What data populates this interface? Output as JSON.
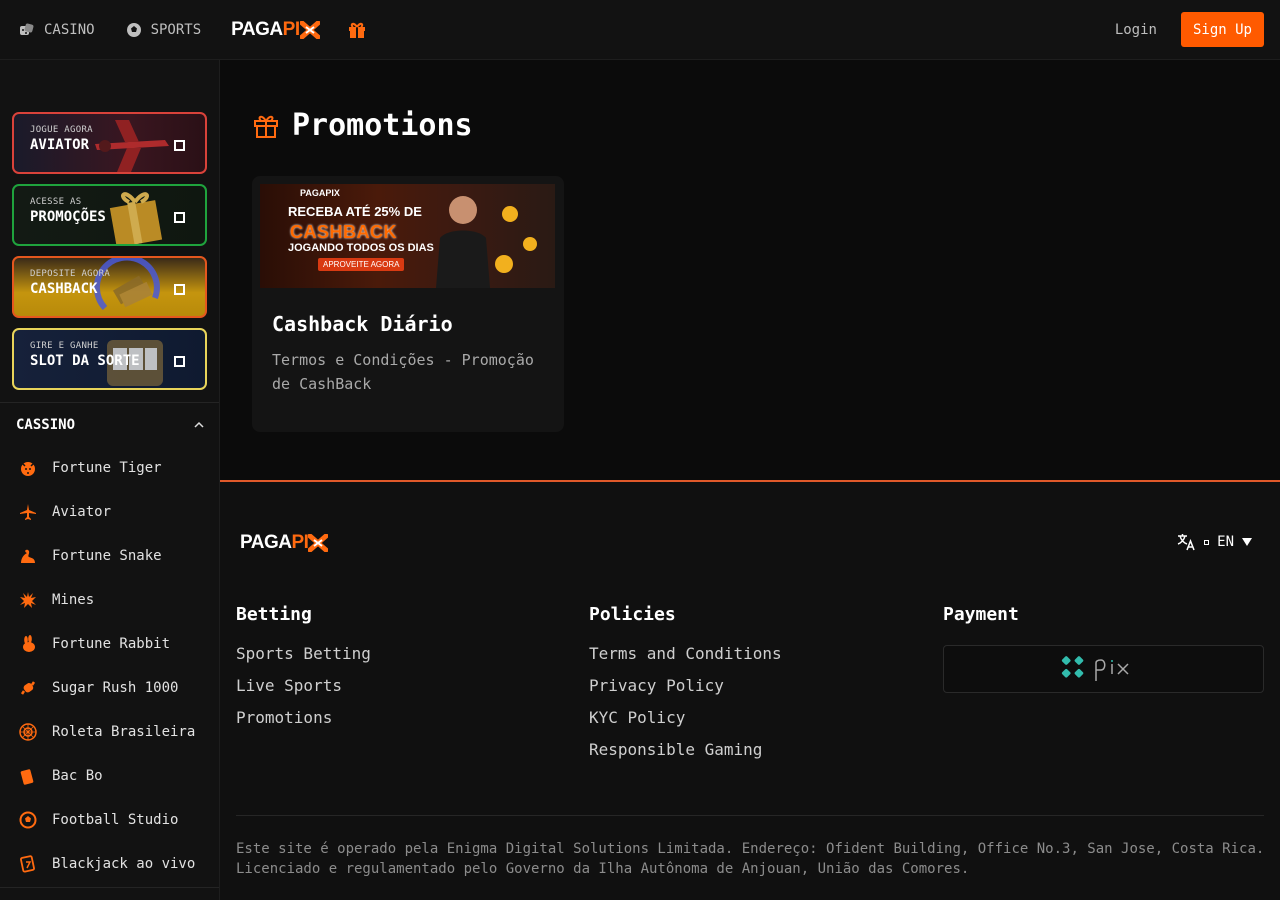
{
  "header": {
    "casino_label": "CASINO",
    "sports_label": "SPORTS",
    "logo_left": "PAGA",
    "logo_right": "PI",
    "login_label": "Login",
    "signup_label": "Sign Up"
  },
  "sidebar": {
    "promo_cards": [
      {
        "small": "JOGUE AGORA",
        "big": "AVIATOR"
      },
      {
        "small": "ACESSE AS",
        "big": "PROMOÇÕES"
      },
      {
        "small": "DEPOSITE AGORA",
        "big": "CASHBACK"
      },
      {
        "small": "GIRE E GANHE",
        "big": "SLOT DA SORTE"
      }
    ],
    "section_title": "CASSINO",
    "games": [
      {
        "label": "Fortune Tiger",
        "icon": "tiger-icon"
      },
      {
        "label": "Aviator",
        "icon": "airplane-icon"
      },
      {
        "label": "Fortune Snake",
        "icon": "snake-icon"
      },
      {
        "label": "Mines",
        "icon": "mine-icon"
      },
      {
        "label": "Fortune Rabbit",
        "icon": "rabbit-icon"
      },
      {
        "label": "Sugar Rush 1000",
        "icon": "candy-icon"
      },
      {
        "label": "Roleta Brasileira",
        "icon": "roulette-icon"
      },
      {
        "label": "Bac Bo",
        "icon": "cards-icon"
      },
      {
        "label": "Football Studio",
        "icon": "football-icon"
      },
      {
        "label": "Blackjack ao vivo",
        "icon": "blackjack-icon"
      }
    ]
  },
  "main": {
    "title": "Promotions",
    "promotion": {
      "banner": {
        "logo": "PAGAPIX",
        "line1": "RECEBA ATÉ 25% DE",
        "line2": "CASHBACK",
        "line3": "JOGANDO TODOS OS DIAS",
        "cta": "APROVEITE AGORA"
      },
      "title": "Cashback Diário",
      "description": "Termos e Condições - Promoção de CashBack"
    }
  },
  "footer": {
    "language": "EN",
    "columns": {
      "betting": {
        "title": "Betting",
        "links": [
          "Sports Betting",
          "Live Sports",
          "Promotions"
        ]
      },
      "policies": {
        "title": "Policies",
        "links": [
          "Terms and Conditions",
          "Privacy Policy",
          "KYC Policy",
          "Responsible Gaming"
        ]
      },
      "payment": {
        "title": "Payment",
        "method": "pix"
      }
    },
    "legal_line1": "Este site é operado pela Enigma Digital Solutions Limitada. Endereço: Ofident Building, Office No.3, San Jose, Costa Rica.",
    "legal_line2": "Licenciado e regulamentado pelo Governo da Ilha Autônoma de Anjouan, União das Comores."
  },
  "colors": {
    "accent": "#ff5a00",
    "background": "#0e0e0e",
    "pix_teal": "#32bcad"
  }
}
